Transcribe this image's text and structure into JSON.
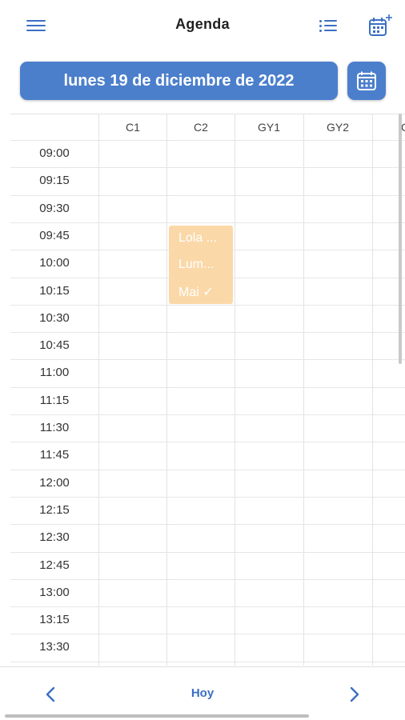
{
  "header": {
    "title": "Agenda",
    "menu_icon": "hamburger-menu-icon",
    "list_icon": "list-icon",
    "add_calendar_icon": "calendar-add-icon"
  },
  "date_bar": {
    "date_label": "lunes 19 de diciembre de 2022",
    "calendar_icon": "calendar-icon"
  },
  "columns": [
    "C1",
    "C2",
    "GY1",
    "GY2",
    "CI"
  ],
  "times": [
    "09:00",
    "09:15",
    "09:30",
    "09:45",
    "10:00",
    "10:15",
    "10:30",
    "10:45",
    "11:00",
    "11:15",
    "11:30",
    "11:45",
    "12:00",
    "12:15",
    "12:30",
    "12:45",
    "13:00",
    "13:15",
    "13:30"
  ],
  "appointment": {
    "column": "C2",
    "start": "09:45",
    "lines": [
      "Lola ...",
      "Lum...",
      "Mai ✓"
    ],
    "color": "#fbd8a8"
  },
  "footer": {
    "prev_icon": "chevron-left-icon",
    "today_label": "Hoy",
    "next_icon": "chevron-right-icon"
  },
  "colors": {
    "accent": "#4b7fcc",
    "appointment": "#fbd8a8"
  }
}
